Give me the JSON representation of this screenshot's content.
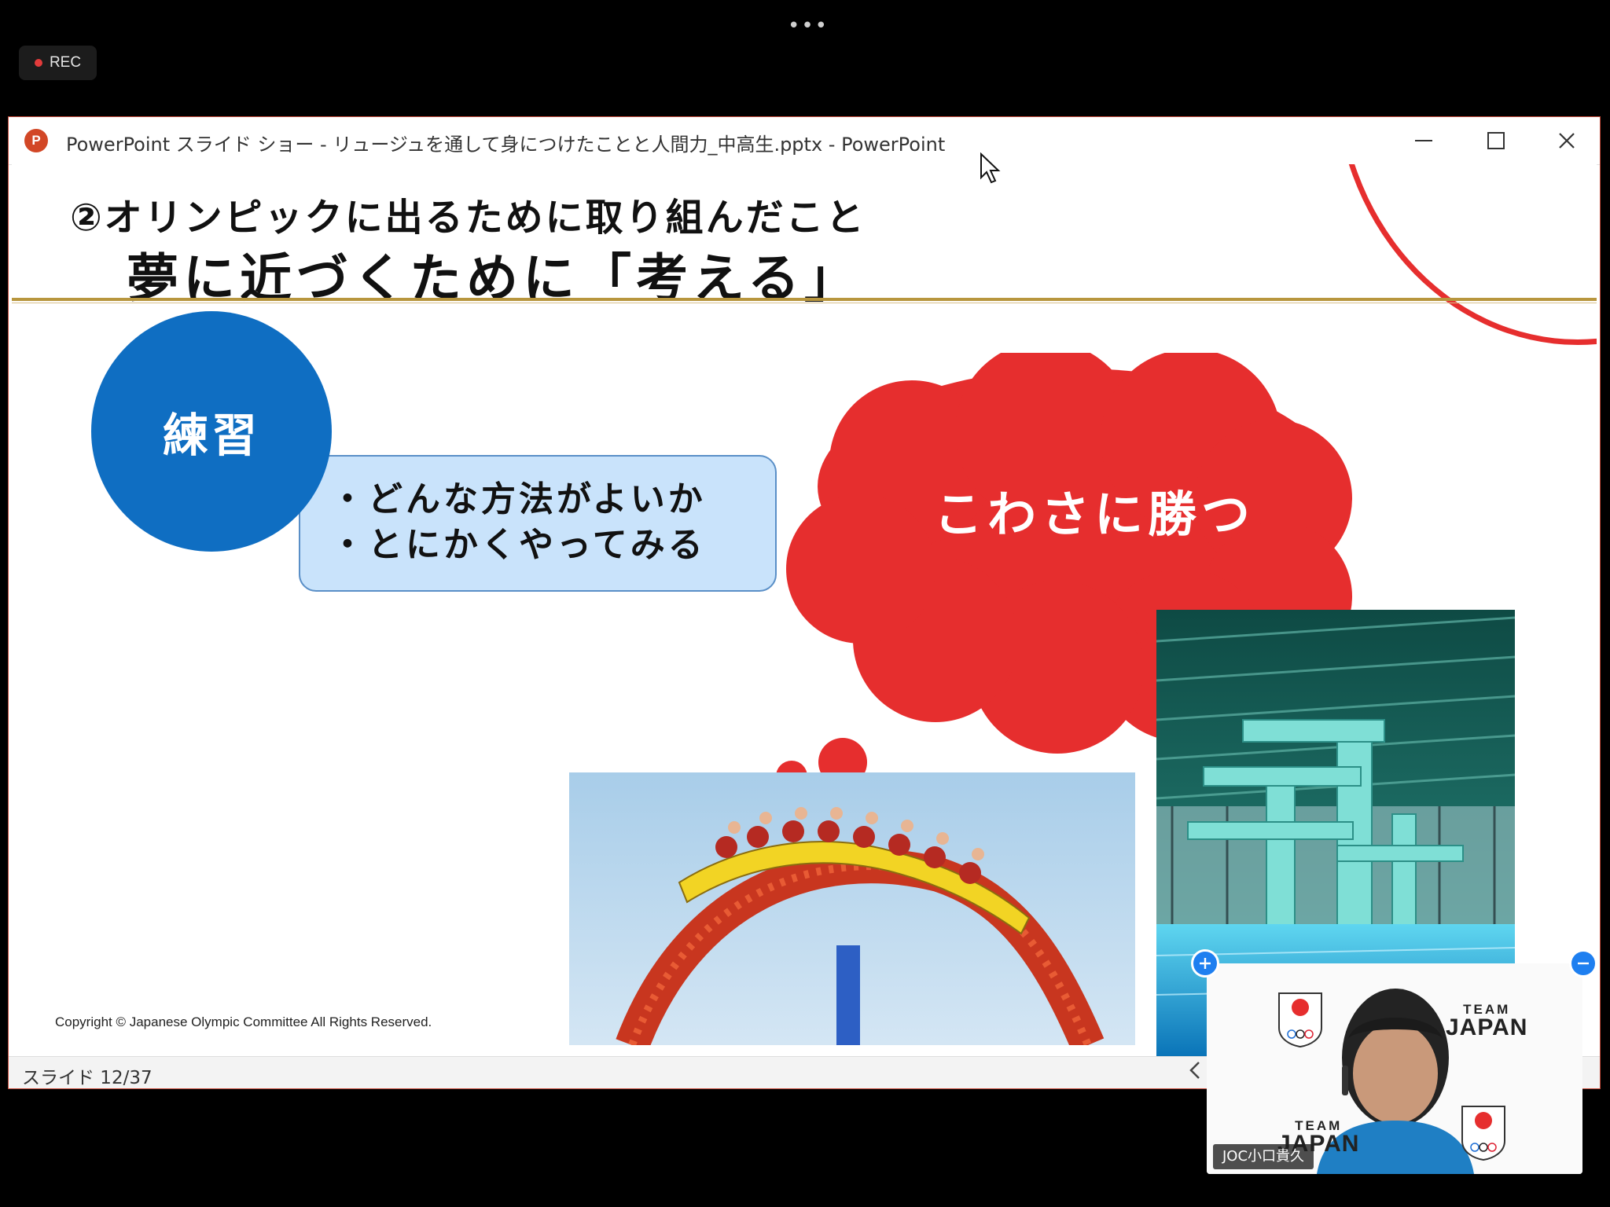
{
  "overlay": {
    "more_dots": "•••",
    "rec_label": "REC"
  },
  "window": {
    "title": "PowerPoint スライド ショー  -  リュージュを通して身につけたことと人間力_中高生.pptx - PowerPoint",
    "logo_letter": "P"
  },
  "slide": {
    "title_line1": "②オリンピックに出るために取り組んだこと",
    "title_line2": "夢に近づくために「考える」",
    "circle_label": "練習",
    "note_lines": [
      "・どんな方法がよいか",
      "・とにかくやってみる"
    ],
    "cloud_text": "こわさに勝つ",
    "copyright": "Copyright © Japanese Olympic Committee All Rights Reserved."
  },
  "statusbar": {
    "slide_counter": "スライド 12/37"
  },
  "video": {
    "participant_name": "JOC小口貴久",
    "team_small": "TEAM",
    "team_big": "JAPAN",
    "emblem_text": "TEAM JAPAN"
  },
  "colors": {
    "accent_red": "#e62e2e",
    "circle_blue": "#0f6ec2",
    "note_fill": "#c9e3fb",
    "gold_rule": "#b8963e",
    "zoom_blue": "#1e7ff0"
  },
  "icons": {
    "app": "powerpoint-icon",
    "minimize": "minimize-icon",
    "maximize": "maximize-icon",
    "close": "close-icon",
    "cursor": "mouse-pointer-icon",
    "zoom_in": "plus-icon",
    "zoom_out": "minus-icon"
  }
}
